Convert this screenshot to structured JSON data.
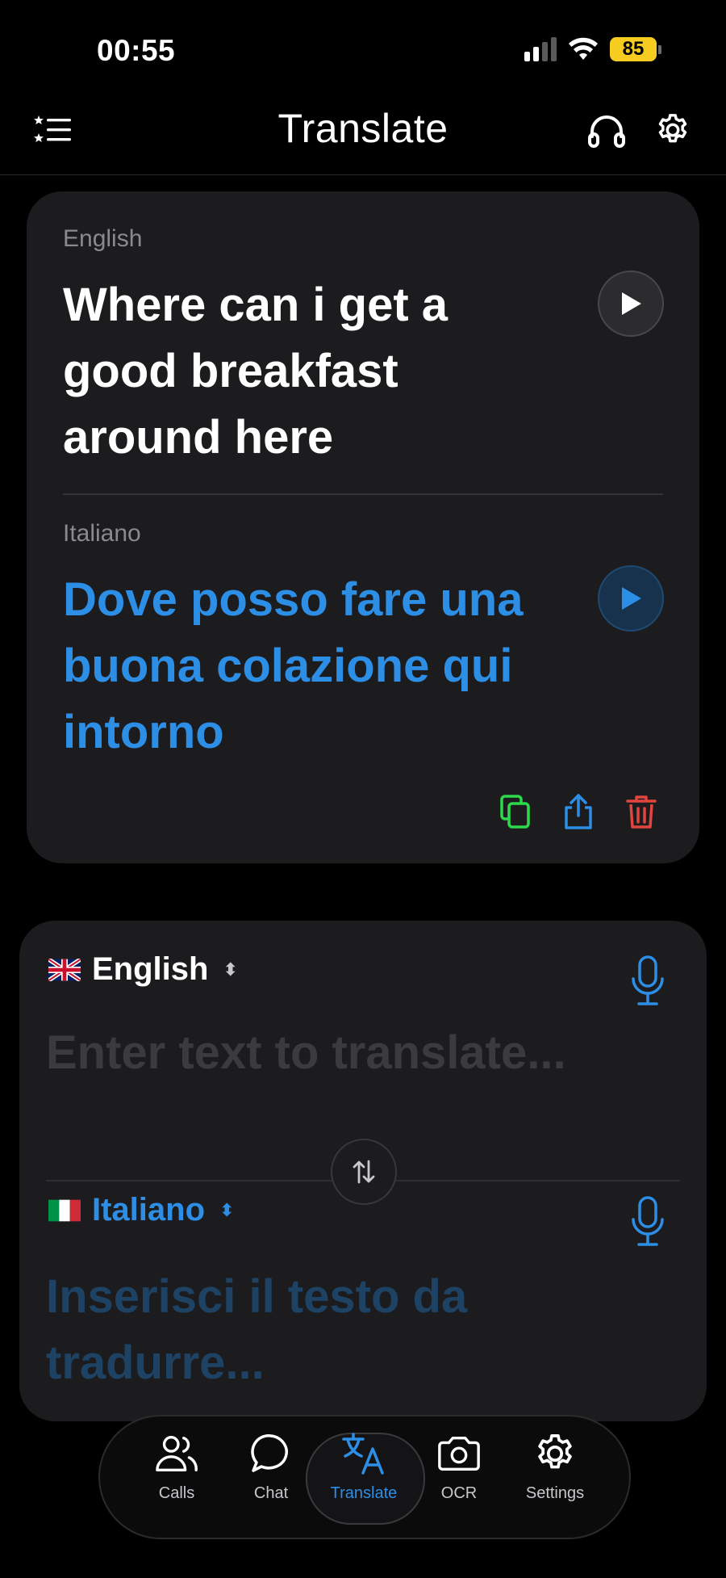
{
  "status_bar": {
    "time": "00:55",
    "battery": "85"
  },
  "header": {
    "title": "Translate"
  },
  "result": {
    "source_language": "English",
    "source_text": "Where can i get a good breakfast around here",
    "target_language": "Italiano",
    "target_text": "Dove posso fare una buona colazione qui intorno"
  },
  "input": {
    "source_language": "English",
    "source_placeholder": "Enter text to translate...",
    "target_language": "Italiano",
    "target_placeholder": "Inserisci il testo da tradurre..."
  },
  "tabs": [
    {
      "label": "Calls",
      "icon": "people-icon"
    },
    {
      "label": "Chat",
      "icon": "chat-bubble-icon"
    },
    {
      "label": "Translate",
      "icon": "translate-icon",
      "active": true
    },
    {
      "label": "OCR",
      "icon": "camera-icon"
    },
    {
      "label": "Settings",
      "icon": "gear-icon"
    }
  ],
  "colors": {
    "accent": "#2d8ee6",
    "card": "#1c1c1e",
    "copy": "#2bd94a",
    "delete": "#e0453e",
    "battery": "#f5cc1f"
  }
}
